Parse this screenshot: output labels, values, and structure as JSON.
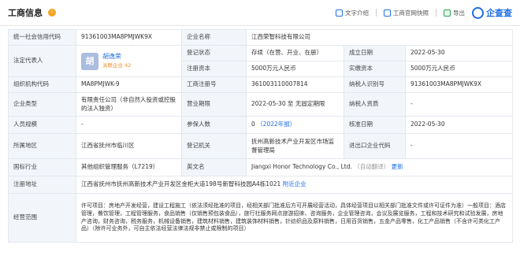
{
  "header": {
    "title": "工商信息",
    "badge": "i",
    "tools": {
      "text_intro": "文字介绍",
      "official_snapshot": "工商官网快照",
      "export": "导出"
    },
    "logo_text": "企查查",
    "colors": {
      "accent": "#1e6ee6",
      "label_bg": "#f2f6fb",
      "orange": "#f08d2c"
    }
  },
  "rows": {
    "credit_code_label": "统一社会信用代码",
    "credit_code": "91361003MA8PMJWK9X",
    "company_name_label": "企业名称",
    "company_name": "江西荣智科技有限公司",
    "legal_rep_label": "法定代表人",
    "legal_rep_avatar": "胡",
    "legal_rep_name": "胡逸荣",
    "legal_rep_related": "关联企业 42",
    "reg_status_label": "登记状态",
    "reg_status": "存续（在营、开业、在册）",
    "found_date_label": "成立日期",
    "found_date": "2022-05-30",
    "reg_capital_label": "注册资本",
    "reg_capital": "5000万元人民币",
    "paid_capital_label": "实缴资本",
    "paid_capital": "5000万元人民币",
    "org_code_label": "组织机构代码",
    "org_code": "MA8PMJWK-9",
    "biz_reg_no_label": "工商注册号",
    "biz_reg_no": "361003110007814",
    "taxpayer_id_label": "纳税人识别号",
    "taxpayer_id": "91361003MA8PMJWK9X",
    "company_type_label": "企业类型",
    "company_type": "有限责任公司（非自然人投资或控股的法人独资）",
    "biz_term_label": "营业期限",
    "biz_term": "2022-05-30 至 无固定期限",
    "taxpayer_quali_label": "纳税人资质",
    "taxpayer_quali": "-",
    "staff_size_label": "人员规模",
    "staff_size": "-",
    "insured_label": "参保人数",
    "insured_count": "0",
    "insured_year": "（2022年报）",
    "approve_date_label": "核准日期",
    "approve_date": "2022-05-30",
    "region_label": "所属地区",
    "region": "江西省抚州市临川区",
    "reg_authority_label": "登记机关",
    "reg_authority": "抚州高新技术产业开发区市场监督管理局",
    "import_export_label": "进出口企业代码",
    "import_export": "-",
    "industry_label": "国标行业",
    "industry": "其他组织管理服务（L7219）",
    "english_name_label": "英文名",
    "english_name": "Jiangxi Honor Technology Co., Ltd.",
    "english_note": "（自动翻译）",
    "english_more": "更新",
    "address_label": "注册地址",
    "address": "江西省抚州市抚州高新技术产业开发区金柜大道198号新智科技园A4栋1021",
    "address_nearby": "附近企业",
    "scope_label": "经营范围",
    "scope": "许可项目：房地产开发经营，建设工程施工（依法须经批准的项目，经相关部门批准后方可开展经营活动，具体经营项目以相关部门批准文件或许可证件为准）一般项目：酒店管理，餐饮管理，工程管理服务，食品销售（仅销售预包装食品），旅行社服务网点旅游招徕、咨询服务，企业管理咨询，会议及展览服务，工程和技术研究和试验发展，房地产咨询，财务咨询，税务服务，机械设备销售，建筑材料销售，建筑装饰材料销售，针纺织品及原料销售，日用百货销售，五金产品零售，化工产品销售（不含许可类化工产品）（除许可业务外，可自主依法经营法律法规非禁止或限制的项目）"
  }
}
